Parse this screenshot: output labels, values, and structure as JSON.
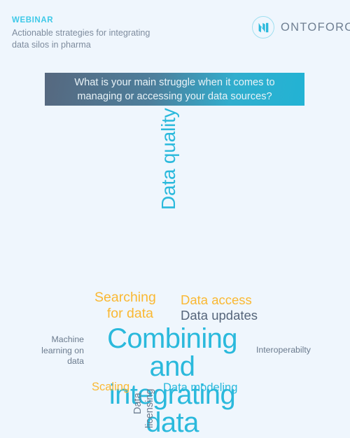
{
  "page": {
    "background_color": "#eff6fd"
  },
  "header": {
    "eyebrow": "WEBINAR",
    "eyebrow_color": "#3ec9e8",
    "subtitle": "Actionable strategies for integrating data silos in pharma",
    "subtitle_color": "#7e8c9e",
    "logo": {
      "wordmark": "ONTOFORCE",
      "mark_icon": "ontoforce-monogram-icon",
      "mark_color": "#2ab9dc",
      "ring_color": "#9fdff0",
      "wordmark_color": "#6f7f92"
    }
  },
  "banner": {
    "question": "What is your main struggle when it comes to\nmanaging or accessing your data sources?",
    "gradient_start": "#56687f",
    "gradient_end": "#22b3d4",
    "text_color": "#e9f3f8"
  },
  "wordcloud": {
    "palette": {
      "cyan": "#2ab9dc",
      "amber": "#fab832",
      "slate": "#55657a",
      "slate_light": "#6b7b8e"
    },
    "words": [
      {
        "id": "data-quality",
        "text": "Data quality",
        "color": "#2ab9dc",
        "size": 28,
        "orientation": "vertical"
      },
      {
        "id": "searching",
        "text": "Searching\nfor data",
        "color": "#fab832",
        "size": 19.5,
        "orientation": "horizontal"
      },
      {
        "id": "data-access",
        "text": "Data access",
        "color": "#fab832",
        "size": 18.5,
        "orientation": "horizontal"
      },
      {
        "id": "data-updates",
        "text": "Data updates",
        "color": "#55657a",
        "size": 18.5,
        "orientation": "horizontal"
      },
      {
        "id": "machine-learning",
        "text": "Machine\nlearning on\ndata",
        "color": "#6b7b8e",
        "size": 12.3,
        "orientation": "horizontal"
      },
      {
        "id": "main",
        "text": "Combining and\nintegrating data",
        "color": "#2ab9dc",
        "size": 40,
        "orientation": "horizontal"
      },
      {
        "id": "interoperability",
        "text": "Interoperabilty",
        "color": "#6b7b8e",
        "size": 12.3,
        "orientation": "horizontal"
      },
      {
        "id": "scaling",
        "text": "Scaling",
        "color": "#fab832",
        "size": 16.5,
        "orientation": "horizontal"
      },
      {
        "id": "data-licensing-1",
        "text": "Data",
        "color": "#6b7b8e",
        "size": 14.5,
        "orientation": "vertical"
      },
      {
        "id": "data-licensing-2",
        "text": "licensing",
        "color": "#6b7b8e",
        "size": 14.5,
        "orientation": "vertical"
      },
      {
        "id": "data-modeling",
        "text": "Data modeling",
        "color": "#2ab9dc",
        "size": 16.5,
        "orientation": "horizontal"
      }
    ]
  }
}
